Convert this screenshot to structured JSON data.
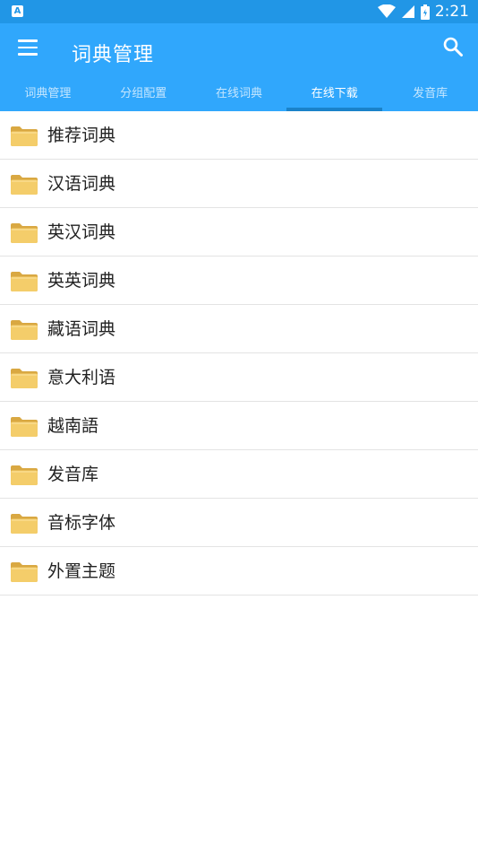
{
  "status_bar": {
    "left_icon": "A",
    "time": "2:21",
    "icons": [
      "wifi-icon",
      "signal-icon",
      "battery-icon"
    ]
  },
  "toolbar": {
    "title": "词典管理",
    "menu_icon": "hamburger-menu-icon",
    "search_icon": "search-icon"
  },
  "tabs": [
    {
      "label": "词典管理",
      "active": false
    },
    {
      "label": "分组配置",
      "active": false
    },
    {
      "label": "在线词典",
      "active": false
    },
    {
      "label": "在线下载",
      "active": true
    },
    {
      "label": "发音库",
      "active": false
    }
  ],
  "folders": [
    {
      "label": "推荐词典"
    },
    {
      "label": "汉语词典"
    },
    {
      "label": "英汉词典"
    },
    {
      "label": "英英词典"
    },
    {
      "label": "藏语词典"
    },
    {
      "label": "意大利语"
    },
    {
      "label": "越南語"
    },
    {
      "label": "发音库"
    },
    {
      "label": "音标字体"
    },
    {
      "label": "外置主题"
    }
  ],
  "colors": {
    "status_bar": "#2196e6",
    "toolbar": "#30a7fc",
    "tab_indicator": "#1a82c9",
    "folder": "#f2c766"
  }
}
